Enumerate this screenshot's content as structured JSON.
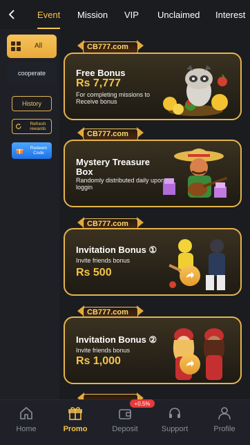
{
  "topnav": {
    "tabs": [
      "Event",
      "Mission",
      "VIP",
      "Unclaimed",
      "Interest"
    ],
    "active": "Event"
  },
  "sidebar": {
    "all_label": "All",
    "cooperate_label": "cooperate",
    "history_label": "History",
    "refresh_label": "Refresh rewards",
    "redeem_label": "Redeem Code"
  },
  "cards": [
    {
      "logo": "CB777.com",
      "title": "Free Bonus",
      "amount": "Rs 7,777",
      "desc": "For completing missions to Receive bonus",
      "icon": "raccoon-mascot-icon"
    },
    {
      "logo": "CB777.com",
      "title": "Mystery Treasure Box",
      "desc": "Randomly distributed daily upon loggin",
      "icon": "mariachi-guitar-icon"
    },
    {
      "logo": "CB777.com",
      "title": "Invitation Bonus ①",
      "desc": "Invite friends bonus",
      "amount": "Rs 500",
      "icon": "cricket-players-icon"
    },
    {
      "logo": "CB777.com",
      "title": "Invitation Bonus ②",
      "desc": "Invite friends bonus",
      "amount": "Rs 1,000",
      "icon": "pilot-girls-icon"
    }
  ],
  "bottomnav": {
    "items": [
      {
        "label": "Home",
        "icon": "home-icon"
      },
      {
        "label": "Promo",
        "icon": "gift-icon"
      },
      {
        "label": "Deposit",
        "icon": "wallet-icon"
      },
      {
        "label": "Support",
        "icon": "headset-icon"
      },
      {
        "label": "Profile",
        "icon": "user-icon"
      }
    ],
    "active": "Promo",
    "deposit_badge": "+0.5%"
  },
  "colors": {
    "accent": "#f5c44a",
    "bg": "#1b1c20"
  }
}
